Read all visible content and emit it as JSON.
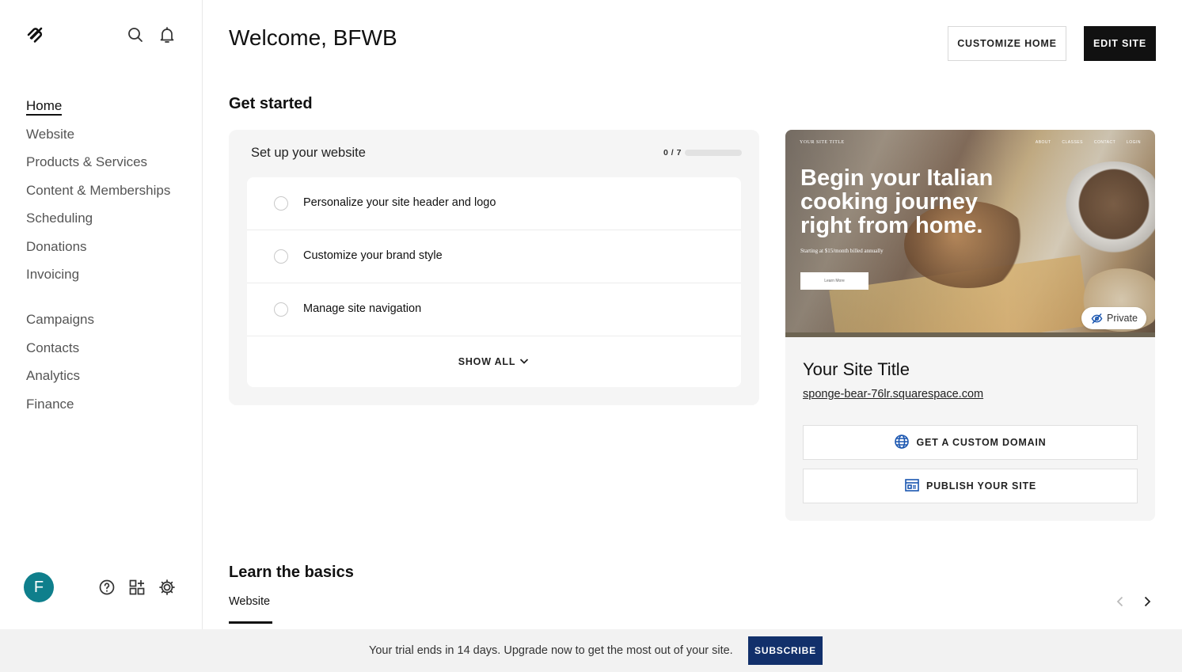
{
  "app": {
    "brand": "Squarespace"
  },
  "sidebar": {
    "primary_items": [
      {
        "label": "Home",
        "active": true
      },
      {
        "label": "Website"
      },
      {
        "label": "Products & Services"
      },
      {
        "label": "Content & Memberships"
      },
      {
        "label": "Scheduling"
      },
      {
        "label": "Donations"
      },
      {
        "label": "Invoicing"
      }
    ],
    "secondary_items": [
      {
        "label": "Campaigns"
      },
      {
        "label": "Contacts"
      },
      {
        "label": "Analytics"
      },
      {
        "label": "Finance"
      }
    ],
    "avatar_initial": "F",
    "avatar_color": "#0f7f8c",
    "top_icons": [
      "search-icon",
      "bell-icon"
    ],
    "bottom_icons": [
      "help-icon",
      "apps-icon",
      "settings-icon"
    ]
  },
  "header": {
    "title": "Welcome, BFWB",
    "customize_home_label": "CUSTOMIZE HOME",
    "edit_site_label": "EDIT SITE"
  },
  "get_started": {
    "heading": "Get started",
    "card_title": "Set up your website",
    "progress_text": "0 / 7",
    "progress_fraction": 0,
    "tasks": [
      {
        "label": "Personalize your site header and logo",
        "done": false
      },
      {
        "label": "Customize your brand style",
        "done": false
      },
      {
        "label": "Manage site navigation",
        "done": false
      }
    ],
    "show_all_label": "SHOW ALL"
  },
  "site_card": {
    "preview": {
      "site_title_small": "YOUR SITE TITLE",
      "nav": "ABOUT CLASSES CONTACT LOGIN",
      "headline": "Begin your Italian cooking journey right from home.",
      "subline": "Starting at $15/month billed annually",
      "button": "Learn More"
    },
    "private_label": "Private",
    "site_title": "Your Site Title",
    "site_url": "sponge-bear-76lr.squarespace.com",
    "custom_domain_label": "GET A CUSTOM DOMAIN",
    "publish_label": "PUBLISH YOUR SITE",
    "accent_color": "#1a56b0"
  },
  "learn": {
    "heading": "Learn the basics",
    "tab_label": "Website"
  },
  "trial": {
    "message": "Your trial ends in 14 days. Upgrade now to get the most out of your site.",
    "subscribe_label": "SUBSCRIBE",
    "subscribe_color": "#12306b"
  }
}
